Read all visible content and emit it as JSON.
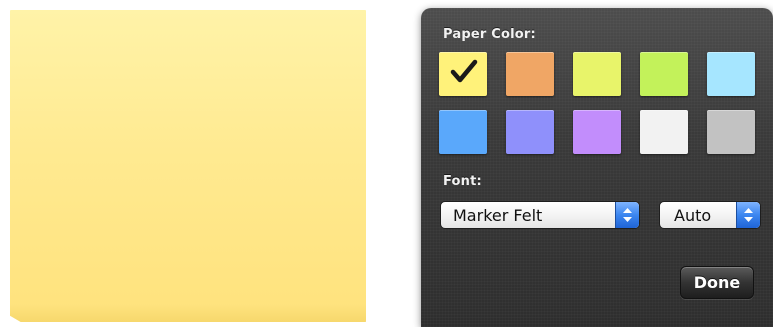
{
  "note": {
    "color": "#FFEA91"
  },
  "settings": {
    "paper_color_label": "Paper Color:",
    "swatches": [
      {
        "name": "yellow",
        "color": "#FFF27A",
        "selected": true
      },
      {
        "name": "orange",
        "color": "#F0A665",
        "selected": false
      },
      {
        "name": "light-yellow-green",
        "color": "#E8F46A",
        "selected": false
      },
      {
        "name": "lime-green",
        "color": "#C3F25A",
        "selected": false
      },
      {
        "name": "light-blue",
        "color": "#A6E6FF",
        "selected": false
      },
      {
        "name": "blue",
        "color": "#5AA8FB",
        "selected": false
      },
      {
        "name": "periwinkle",
        "color": "#8F90FB",
        "selected": false
      },
      {
        "name": "lavender",
        "color": "#C28DFC",
        "selected": false
      },
      {
        "name": "white",
        "color": "#F2F2F2",
        "selected": false
      },
      {
        "name": "gray",
        "color": "#C2C2C2",
        "selected": false
      }
    ],
    "font_label": "Font:",
    "font_value": "Marker Felt",
    "size_value": "Auto",
    "done_label": "Done",
    "check_icon": "checkmark-icon",
    "popup_arrows_icon": "updown-arrows-icon"
  }
}
